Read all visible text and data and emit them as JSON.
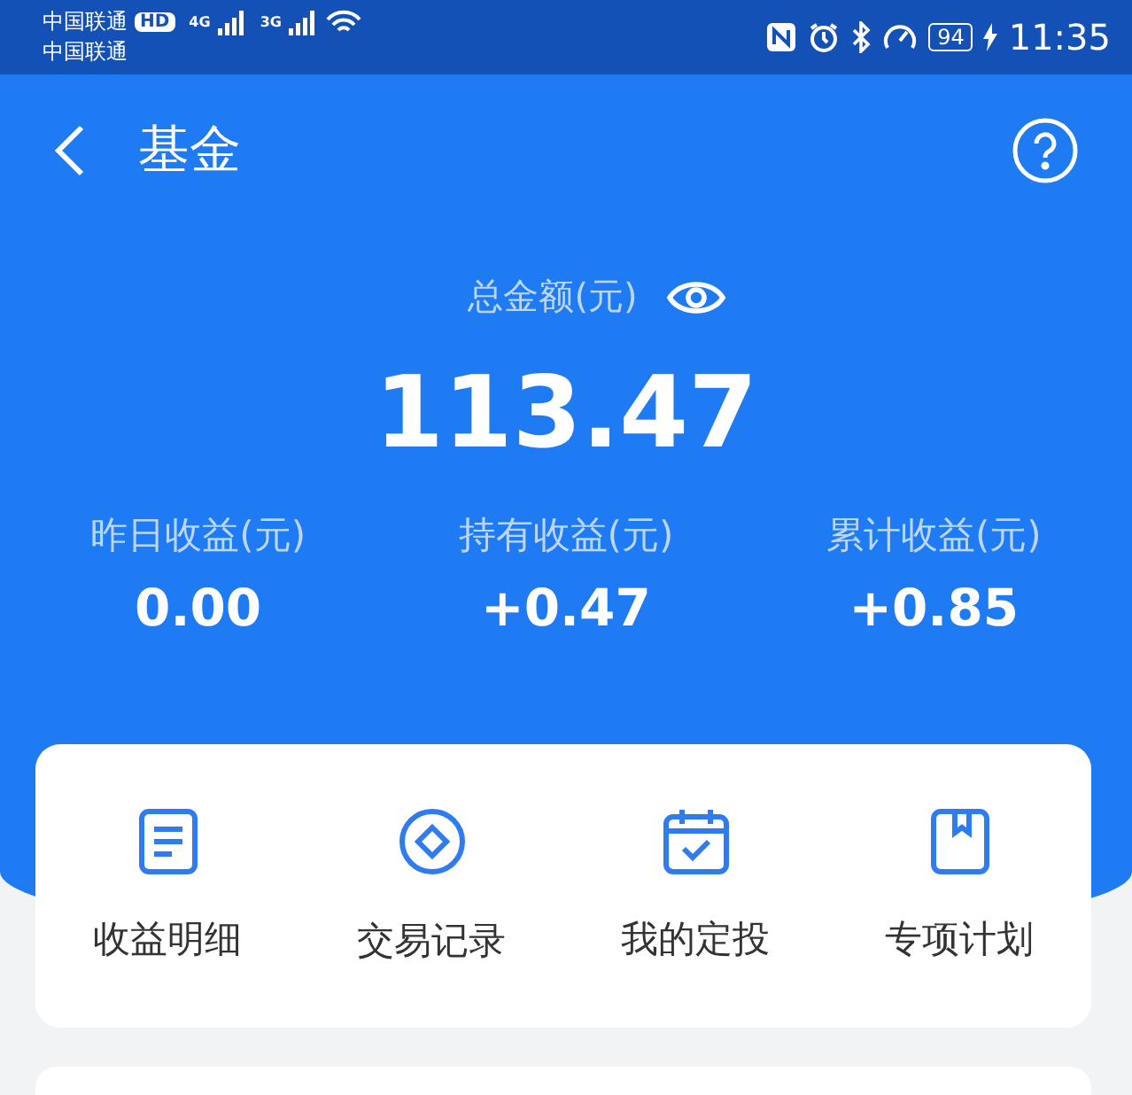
{
  "status_bar": {
    "carriers": [
      "中国联通",
      "中国联通"
    ],
    "hd": "HD",
    "net1": "4G",
    "net2": "3G",
    "battery": "94",
    "time": "11:35"
  },
  "header": {
    "title": "基金"
  },
  "total": {
    "label": "总金额(元)",
    "value": "113.47"
  },
  "stats": [
    {
      "label": "昨日收益(元)",
      "value": "0.00"
    },
    {
      "label": "持有收益(元)",
      "value": "+0.47"
    },
    {
      "label": "累计收益(元)",
      "value": "+0.85"
    }
  ],
  "actions": [
    {
      "label": "收益明细",
      "kind": "document"
    },
    {
      "label": "交易记录",
      "kind": "coin"
    },
    {
      "label": "我的定投",
      "kind": "calendar"
    },
    {
      "label": "专项计划",
      "kind": "book"
    }
  ]
}
